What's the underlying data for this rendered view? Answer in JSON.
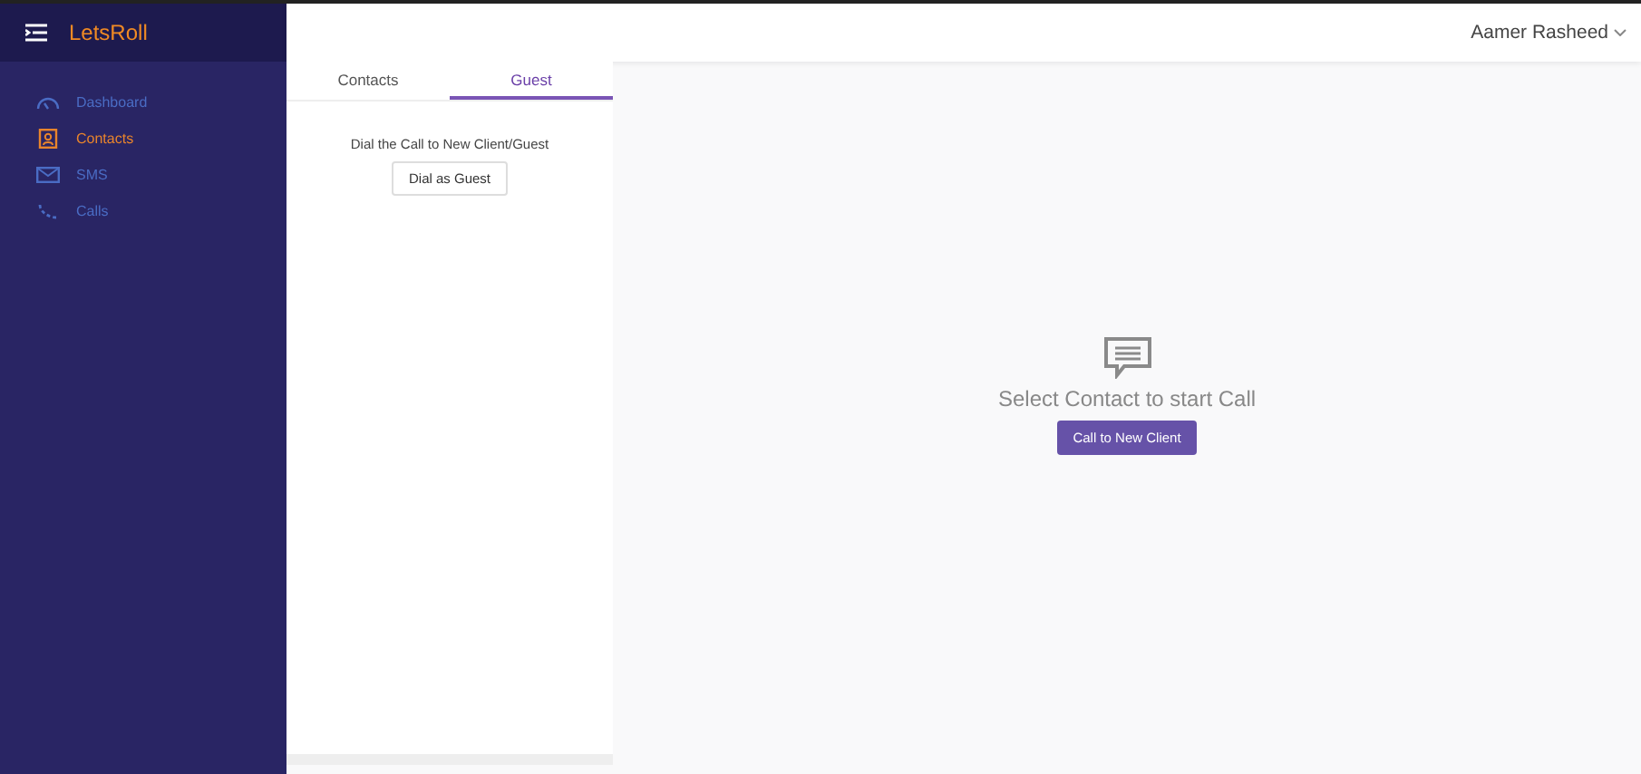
{
  "brand": "LetsRoll",
  "sidebar": {
    "items": [
      {
        "label": "Dashboard",
        "kind": "dashboard",
        "selected": false
      },
      {
        "label": "Contacts",
        "kind": "contacts",
        "selected": true
      },
      {
        "label": "SMS",
        "kind": "sms",
        "selected": false
      },
      {
        "label": "Calls",
        "kind": "calls",
        "selected": false
      }
    ]
  },
  "user": "Aamer Rasheed",
  "tabs": [
    {
      "label": "Contacts",
      "selected": false
    },
    {
      "label": "Guest",
      "selected": true
    }
  ],
  "guest": {
    "text": "Dial the Call to New Client/Guest",
    "button": "Dial as Guest"
  },
  "empty_state": {
    "message": "Select Contact to start Call",
    "button": "Call to New Client"
  }
}
